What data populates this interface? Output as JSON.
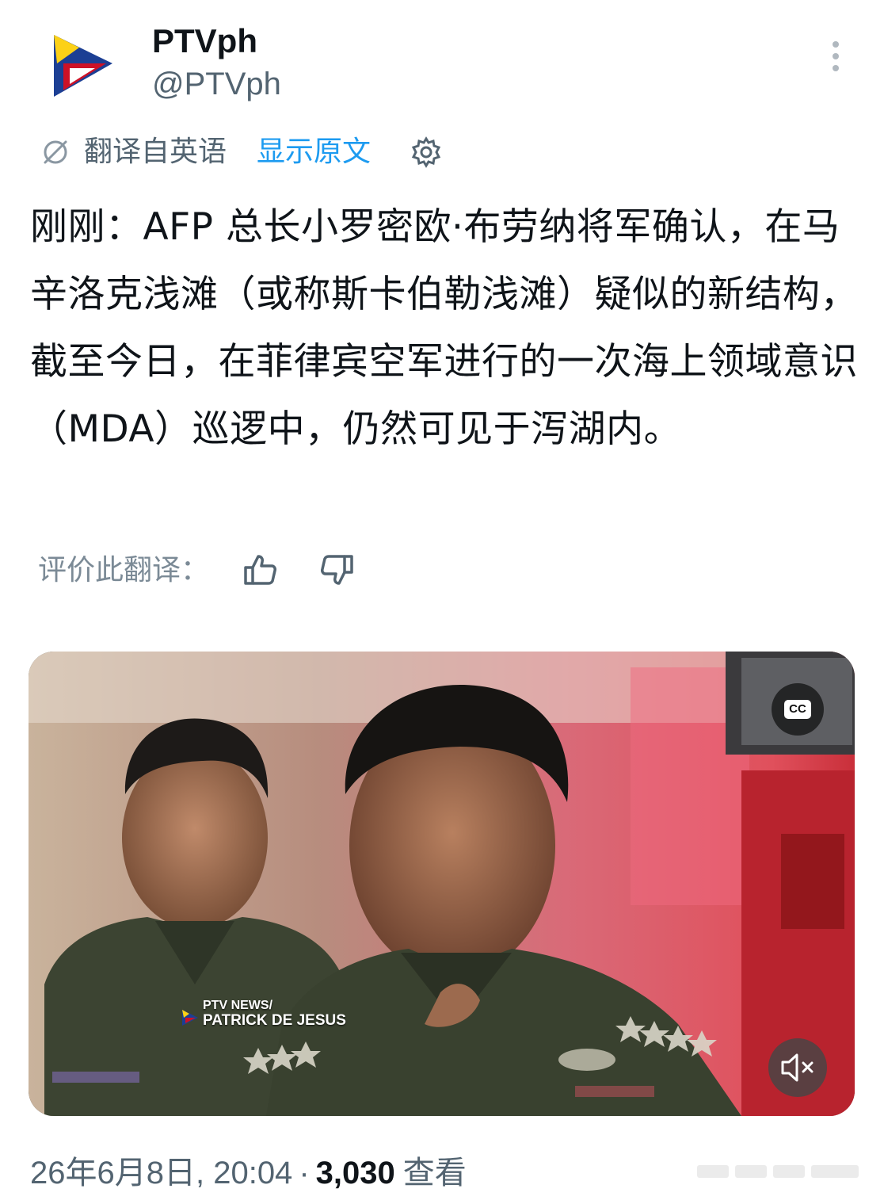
{
  "account": {
    "name": "PTVph",
    "handle": "@PTVph"
  },
  "translation": {
    "translated_label": "翻译自英语",
    "show_original": "显示原文",
    "rate_label": "评价此翻译："
  },
  "post": {
    "text": "刚刚：AFP 总长小罗密欧·布劳纳将军确认，在马辛洛克浅滩（或称斯卡伯勒浅滩）疑似的新结构，截至今日，在菲律宾空军进行的一次海上领域意识（MDA）巡逻中，仍然可见于泻湖内。"
  },
  "video": {
    "lower_third_line1": "PTV NEWS/",
    "lower_third_line2": "PATRICK DE JESUS",
    "cc_label": "CC"
  },
  "meta": {
    "date": "26年6月8日, 20:04",
    "separator": "·",
    "view_count": "3,030",
    "views_label": "查看"
  },
  "colors": {
    "accent": "#1d9bf0",
    "text": "#0f1419",
    "secondary": "#536471"
  },
  "icons": {
    "more": "more-vertical-icon",
    "translate": "translate-icon",
    "settings": "gear-icon",
    "like": "thumbs-up-icon",
    "dislike": "thumbs-down-icon",
    "cc": "closed-captions-icon",
    "mute": "volume-muted-icon"
  }
}
